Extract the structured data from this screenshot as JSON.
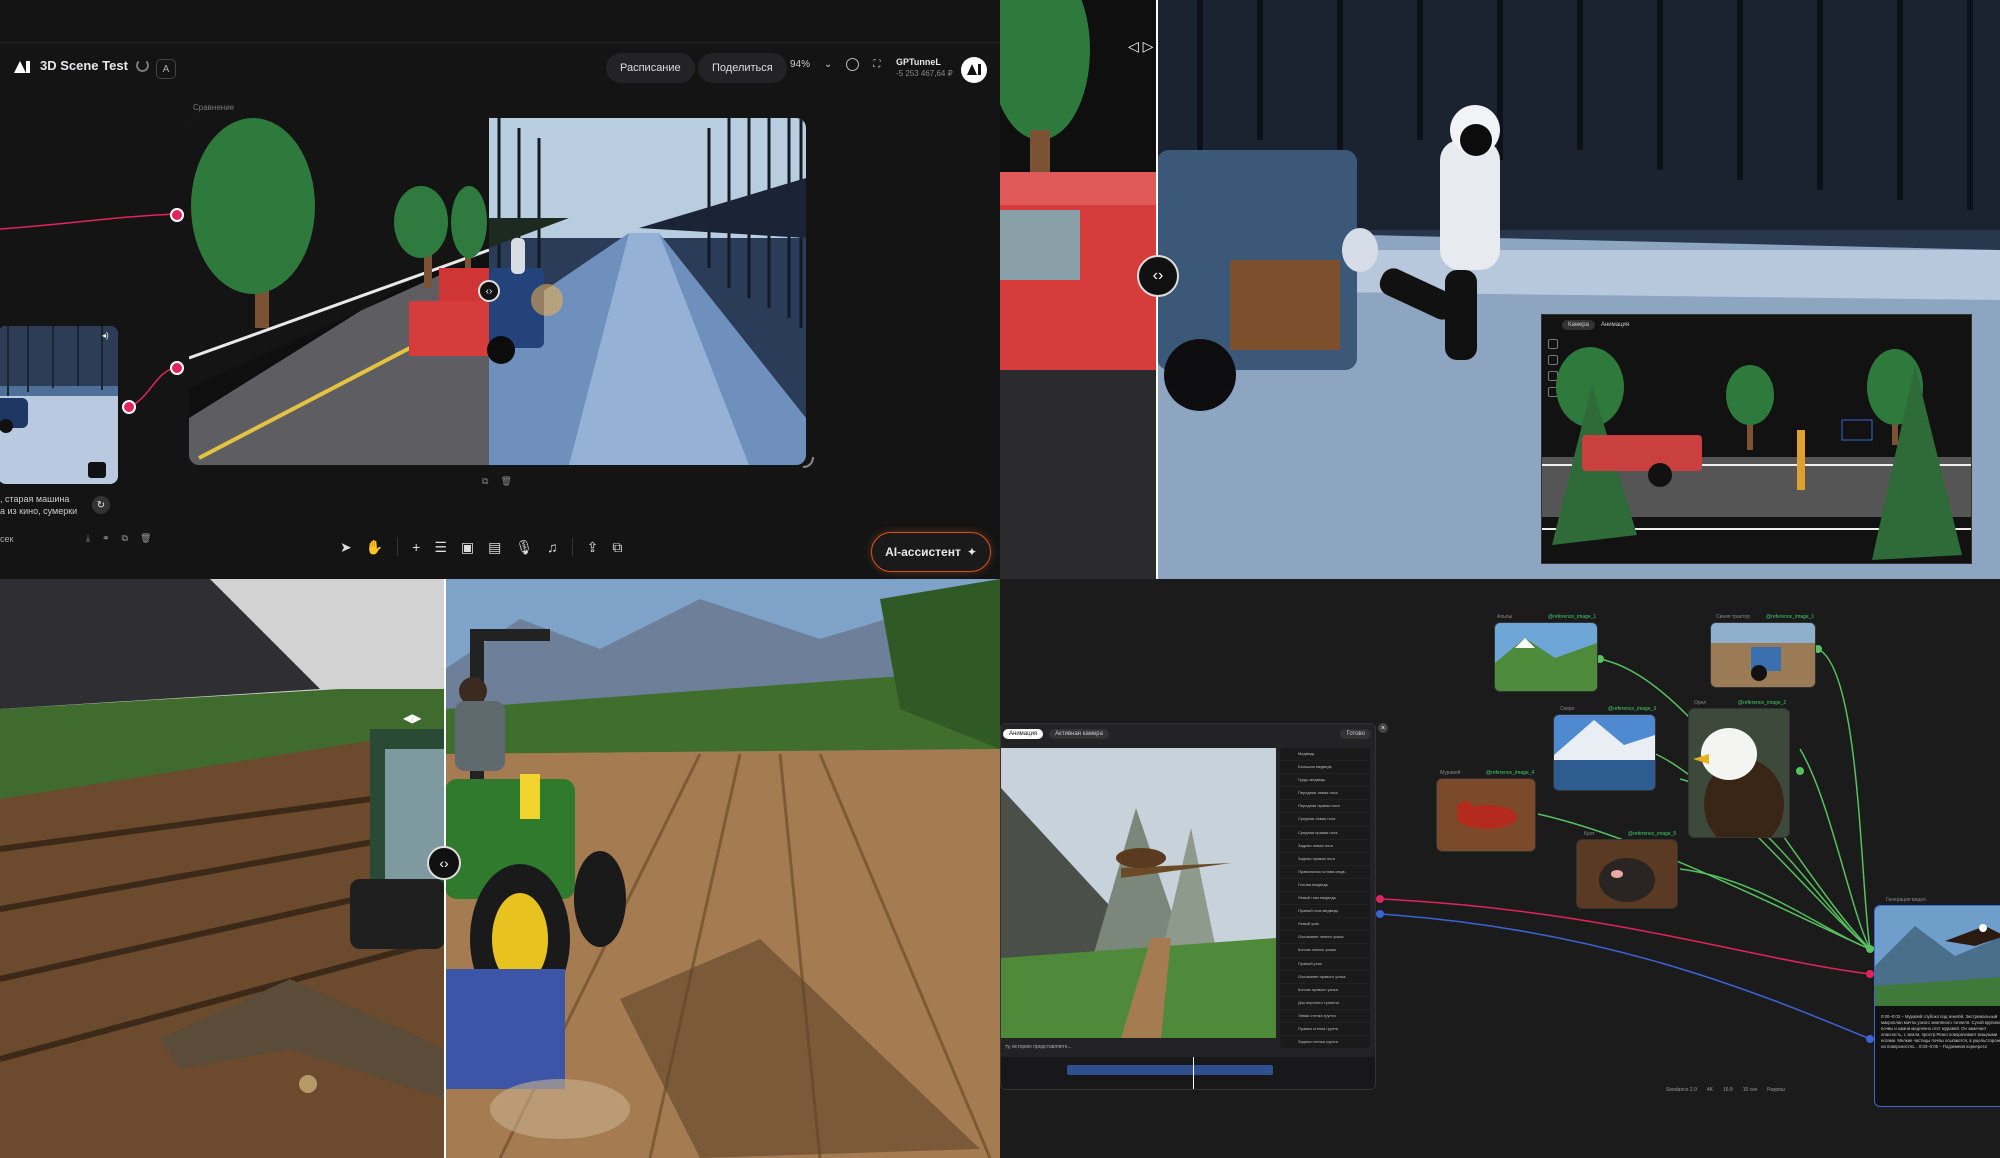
{
  "editor": {
    "project_name": "3D Scene Test",
    "project_badge": "A",
    "schedule_label": "Расписание",
    "share_label": "Поделиться",
    "zoom_level": "94%",
    "user_name": "GPTunneL",
    "user_balance": "-5 253 467,64 ₽",
    "comparison_label": "Сравнение",
    "node_caption": ", старая машина\nа из кино, сумерки",
    "duration": "сек",
    "ai_assistant_label": "AI-ассистент",
    "ai_assistant_icon": "sparkle-icon",
    "accent_color": "#e0245e",
    "toolbar_icons": [
      "cursor-icon",
      "hand-icon",
      "plus-icon",
      "text-icon",
      "image-icon",
      "video-icon",
      "mic-icon",
      "music-icon",
      "upload-icon",
      "layers-icon"
    ]
  },
  "q2": {
    "inset_tabs": [
      "Камера",
      "Анимация"
    ]
  },
  "graph": {
    "panel_tabs": [
      "Анимация",
      "Активная камера"
    ],
    "panel_right_tag": "Готово",
    "layers": [
      "Медведь",
      "Большая медведь",
      "Грудь медведь",
      "Передняя левая нога",
      "Передняя правая нога",
      "Средняя левая нога",
      "Средняя правая нога",
      "Задняя левая нога",
      "Задняя правая нога",
      "Правильная голова медв..",
      "Голова медведь",
      "Левый глаз медведь",
      "Правый глаз медведь",
      "Левый усик",
      "Основание левого усика",
      "Кончик левого усика",
      "Правый усик",
      "Основание правого усика",
      "Кончик правого усика",
      "Дно верхнего туннеля",
      "Левая стенка грунта",
      "Правая стенка грунта",
      "Задняя стенка грунта"
    ],
    "prompt_text": "ту, историю представляете...",
    "nodes": [
      {
        "title": "Альпы",
        "tag": "@reference_image_1"
      },
      {
        "title": "Синяя трактор",
        "tag": "@reference_image_1"
      },
      {
        "title": "Озеро",
        "tag": "@reference_image_3"
      },
      {
        "title": "Орел",
        "tag": "@reference_image_2"
      },
      {
        "title": "Муравей",
        "tag": "@reference_image_4"
      },
      {
        "title": "Крот",
        "tag": "@reference_image_5"
      }
    ],
    "result_title": "Генерация видео",
    "result_text": "0:00–0:03 – Муравей глубоко под землёй. Экстремальный макроплан мачты узкого земляного тоннеля. Сухой крупинки почвы и камни медленно отхт муравей. Он замечает опасность, с земли, простр.Резко поворачивает мощными ногами. Мелкие частицы почвы осыпаются, а ущельстороны на поверхностях... 0:03–0:05 – Подземная корнерота",
    "status_items": [
      "Seedance 2.0",
      "4K",
      "16:9",
      "10 сек",
      "Разреш"
    ]
  }
}
